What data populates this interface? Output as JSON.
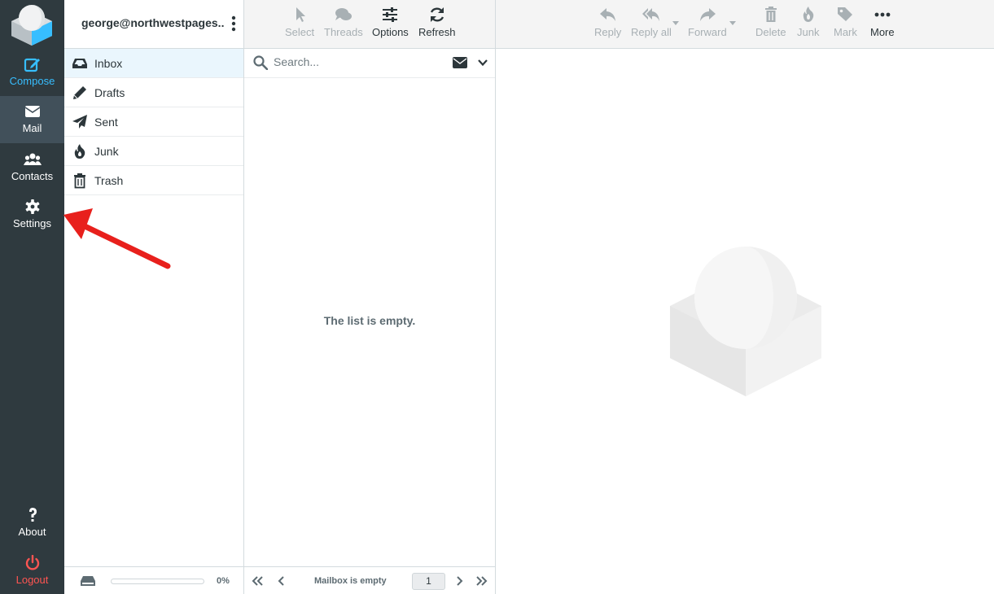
{
  "nav": {
    "compose": "Compose",
    "mail": "Mail",
    "contacts": "Contacts",
    "settings": "Settings",
    "about": "About",
    "logout": "Logout",
    "logo": "roundcube-logo"
  },
  "account": {
    "email": "george@northwestpages...."
  },
  "folders": [
    {
      "label": "Inbox",
      "icon": "inbox-icon",
      "active": true
    },
    {
      "label": "Drafts",
      "icon": "pencil-icon"
    },
    {
      "label": "Sent",
      "icon": "paper-plane-icon"
    },
    {
      "label": "Junk",
      "icon": "fire-icon"
    },
    {
      "label": "Trash",
      "icon": "trash-icon"
    }
  ],
  "quota": {
    "text": "0%",
    "fraction": 0
  },
  "list_toolbar": {
    "select": "Select",
    "threads": "Threads",
    "options": "Options",
    "refresh": "Refresh"
  },
  "search": {
    "placeholder": "Search..."
  },
  "list": {
    "empty_message": "The list is empty.",
    "status": "Mailbox is empty",
    "page": "1"
  },
  "preview_toolbar": {
    "reply": "Reply",
    "reply_all": "Reply all",
    "forward": "Forward",
    "delete": "Delete",
    "junk": "Junk",
    "mark": "Mark",
    "more": "More"
  },
  "colors": {
    "nav_bg": "#2f3a3f",
    "nav_active": "#41505a",
    "accent": "#37beff",
    "logout": "#ff5552",
    "annotation_arrow": "#e8201c"
  }
}
